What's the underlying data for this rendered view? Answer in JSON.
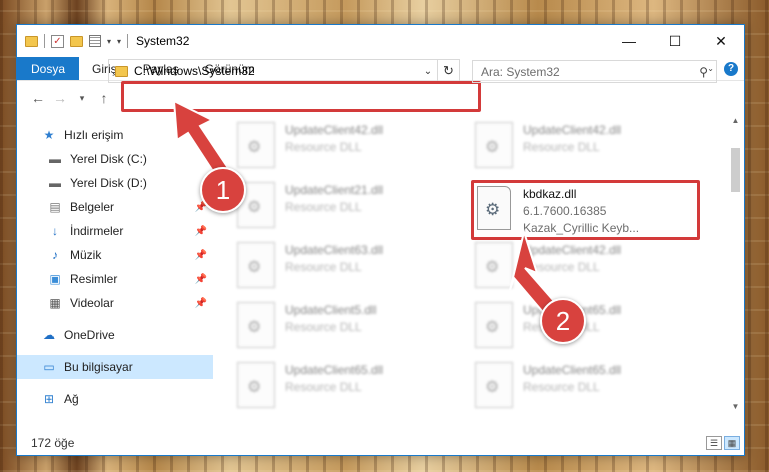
{
  "window": {
    "title": "System32",
    "controls": {
      "minimize": "—",
      "maximize": "☐",
      "close": "✕"
    }
  },
  "ribbon": {
    "tabs": [
      "Dosya",
      "Giriş",
      "Paylaş",
      "Görünüm"
    ],
    "help": "?"
  },
  "navigation": {
    "address": "C:\\Windows\\System32",
    "search_placeholder": "Ara: System32"
  },
  "sidebar": {
    "items": [
      {
        "label": "Hızlı erişim",
        "icon": "star-icon"
      },
      {
        "label": "Yerel Disk (C:)",
        "icon": "drive-icon"
      },
      {
        "label": "Yerel Disk (D:)",
        "icon": "drive-icon"
      },
      {
        "label": "Belgeler",
        "icon": "documents-icon"
      },
      {
        "label": "İndirmeler",
        "icon": "download-icon"
      },
      {
        "label": "Müzik",
        "icon": "music-icon"
      },
      {
        "label": "Resimler",
        "icon": "pictures-icon"
      },
      {
        "label": "Videolar",
        "icon": "videos-icon"
      },
      {
        "label": "OneDrive",
        "icon": "cloud-icon"
      },
      {
        "label": "Bu bilgisayar",
        "icon": "computer-icon"
      },
      {
        "label": "Ağ",
        "icon": "network-icon"
      }
    ]
  },
  "files": {
    "background": [
      {
        "name": "UpdateClient42.dll",
        "type": "Resource DLL"
      },
      {
        "name": "UpdateClient42.dll",
        "type": "Resource DLL"
      },
      {
        "name": "UpdateClient21.dll",
        "type": "Resource DLL"
      },
      {
        "name": "UpdateClient63.dll",
        "type": "Resource DLL"
      },
      {
        "name": "UpdateClient42.dll",
        "type": "Resource DLL"
      },
      {
        "name": "UpdateClient5.dll",
        "type": "Resource DLL"
      },
      {
        "name": "UpdateClient65.dll",
        "type": "Resource DLL"
      },
      {
        "name": "UpdateClient65.dll",
        "type": "Resource DLL"
      },
      {
        "name": "UpdateClient65.dll",
        "type": "Resource DLL"
      }
    ],
    "featured": {
      "name": "kbdkaz.dll",
      "version": "6.1.7600.16385",
      "description": "Kazak_Cyrillic Keyb..."
    }
  },
  "status": {
    "count": "172 öğe"
  },
  "annotations": {
    "step1": "1",
    "step2": "2",
    "color": "#d8423e"
  }
}
